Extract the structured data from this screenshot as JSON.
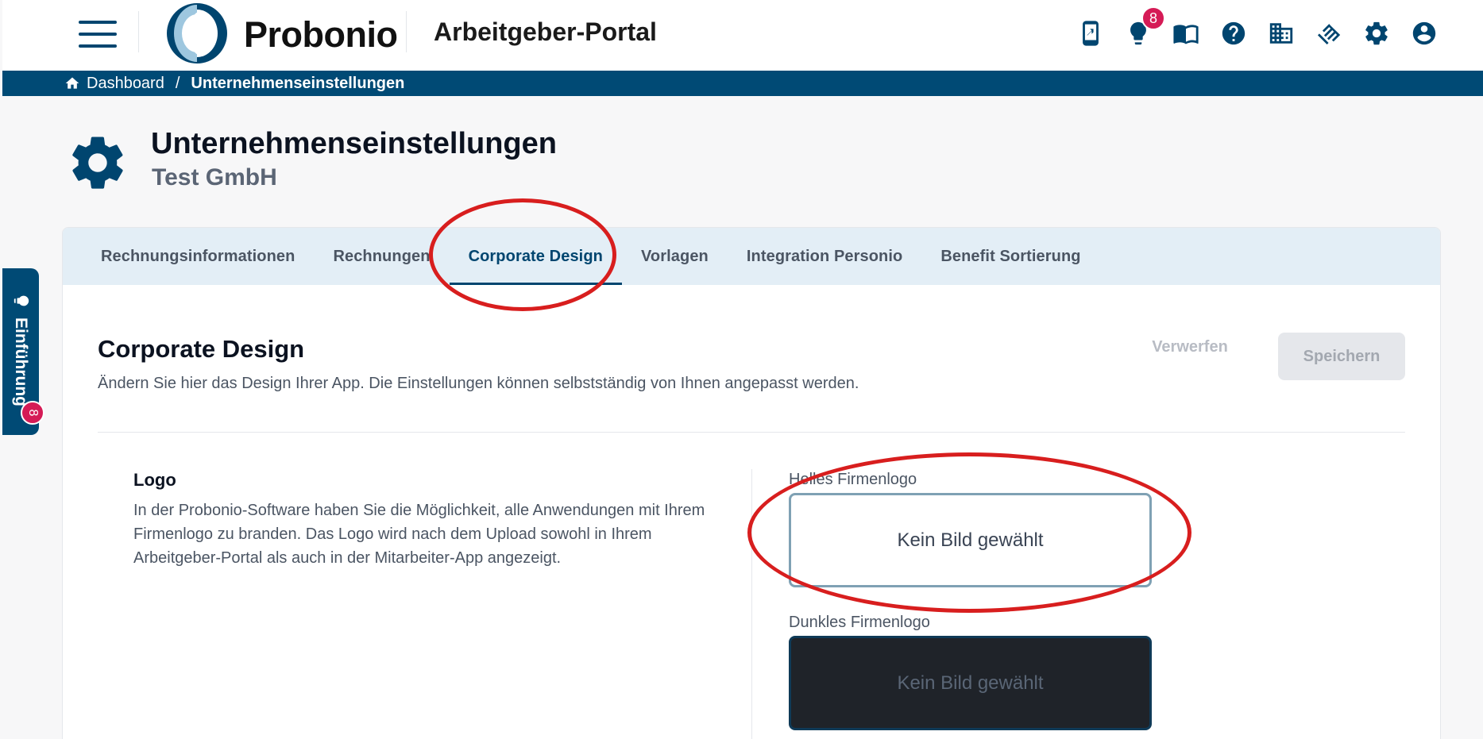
{
  "header": {
    "brand": "Probonio",
    "portal_title": "Arbeitgeber-Portal",
    "notification_count": "8",
    "icons": [
      "mobile-share-icon",
      "lightbulb-icon",
      "book-icon",
      "help-icon",
      "building-icon",
      "handshake-icon",
      "gear-icon",
      "account-icon"
    ]
  },
  "breadcrumb": {
    "home": "Dashboard",
    "separator": "/",
    "current": "Unternehmenseinstellungen"
  },
  "page": {
    "title": "Unternehmenseinstellungen",
    "subtitle": "Test GmbH"
  },
  "intro_tab": {
    "label": "Einführung",
    "badge": "8"
  },
  "tabs": [
    {
      "label": "Rechnungsinformationen",
      "active": false
    },
    {
      "label": "Rechnungen",
      "active": false
    },
    {
      "label": "Corporate Design",
      "active": true
    },
    {
      "label": "Vorlagen",
      "active": false
    },
    {
      "label": "Integration Personio",
      "active": false
    },
    {
      "label": "Benefit Sortierung",
      "active": false
    }
  ],
  "section": {
    "title": "Corporate Design",
    "description": "Ändern Sie hier das Design Ihrer App. Die Einstellungen können selbstständig von Ihnen angepasst werden.",
    "discard_label": "Verwerfen",
    "save_label": "Speichern"
  },
  "logo": {
    "title": "Logo",
    "description": "In der Probonio-Software haben Sie die Möglichkeit, alle Anwendungen mit Ihrem Firmenlogo zu branden. Das Logo wird nach dem Upload sowohl in Ihrem Arbeitgeber-Portal als auch in der Mitarbeiter-App angezeigt.",
    "light_label": "Helles Firmenlogo",
    "light_placeholder": "Kein Bild gewählt",
    "dark_label": "Dunkles Firmenlogo",
    "dark_placeholder": "Kein Bild gewählt"
  },
  "colors": {
    "primary": "#00456f",
    "breadcrumb_bg": "#004a75",
    "tab_bar_bg": "#e3eef6",
    "badge": "#d51b56",
    "annotation": "#d81e1e"
  }
}
